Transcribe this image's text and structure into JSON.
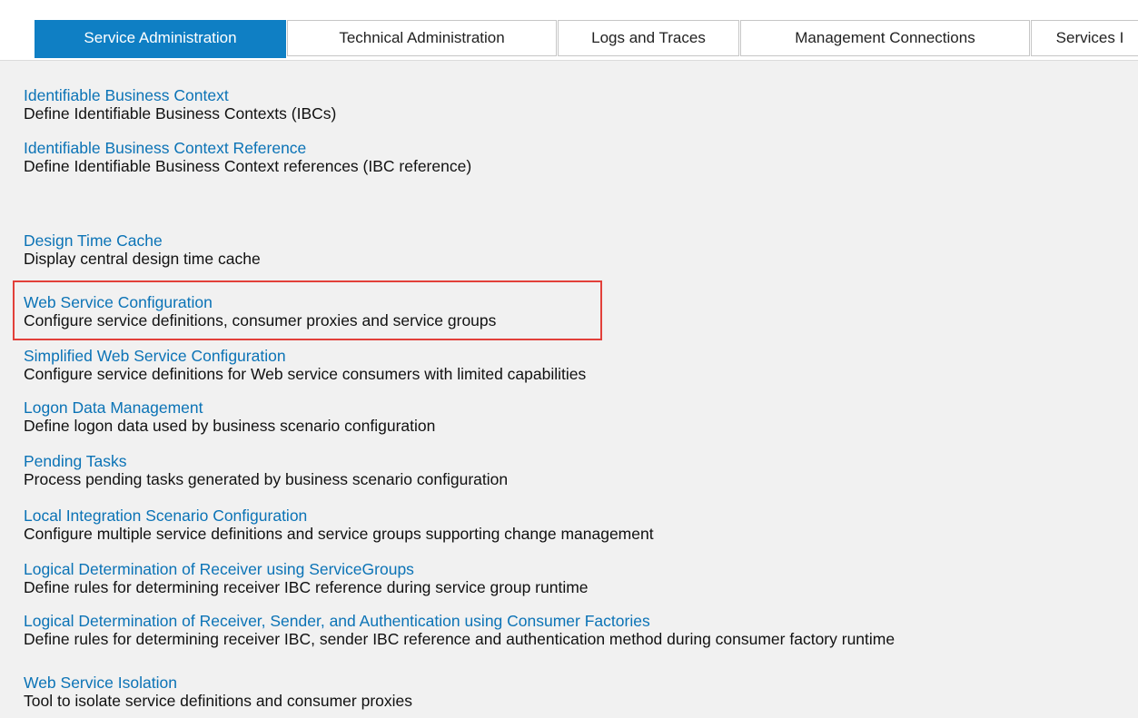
{
  "tabs": [
    {
      "label": "Service Administration",
      "active": true
    },
    {
      "label": "Technical Administration",
      "active": false
    },
    {
      "label": "Logs and Traces",
      "active": false
    },
    {
      "label": "Management Connections",
      "active": false
    },
    {
      "label": "Services I",
      "active": false
    }
  ],
  "items": [
    {
      "title": "Identifiable Business Context",
      "description": "Define Identifiable Business Contexts (IBCs)"
    },
    {
      "title": "Identifiable Business Context Reference",
      "description": "Define Identifiable Business Context references (IBC reference)"
    },
    {
      "title": "Design Time Cache",
      "description": "Display central design time cache"
    },
    {
      "title": "Web Service Configuration",
      "description": "Configure service definitions, consumer proxies and service groups"
    },
    {
      "title": "Simplified Web Service Configuration",
      "description": "Configure service definitions for Web service consumers with limited capabilities"
    },
    {
      "title": "Logon Data Management",
      "description": "Define logon data used by business scenario configuration"
    },
    {
      "title": "Pending Tasks",
      "description": "Process pending tasks generated by business scenario configuration"
    },
    {
      "title": "Local Integration Scenario Configuration",
      "description": "Configure multiple service definitions and service groups supporting change management"
    },
    {
      "title": "Logical Determination of Receiver using ServiceGroups",
      "description": "Define rules for determining receiver IBC reference during service group runtime"
    },
    {
      "title": "Logical Determination of Receiver, Sender, and Authentication using Consumer Factories",
      "description": "Define rules for determining receiver IBC, sender IBC reference and authentication method during consumer factory runtime"
    },
    {
      "title": "Web Service Isolation",
      "description": "Tool to isolate service definitions and consumer proxies"
    }
  ],
  "highlighted_item": "Web Service Configuration",
  "colors": {
    "active_tab": "#0f7fc4",
    "link": "#0b73b6",
    "highlight_border": "#e2403a",
    "content_background": "#f1f1f1"
  }
}
